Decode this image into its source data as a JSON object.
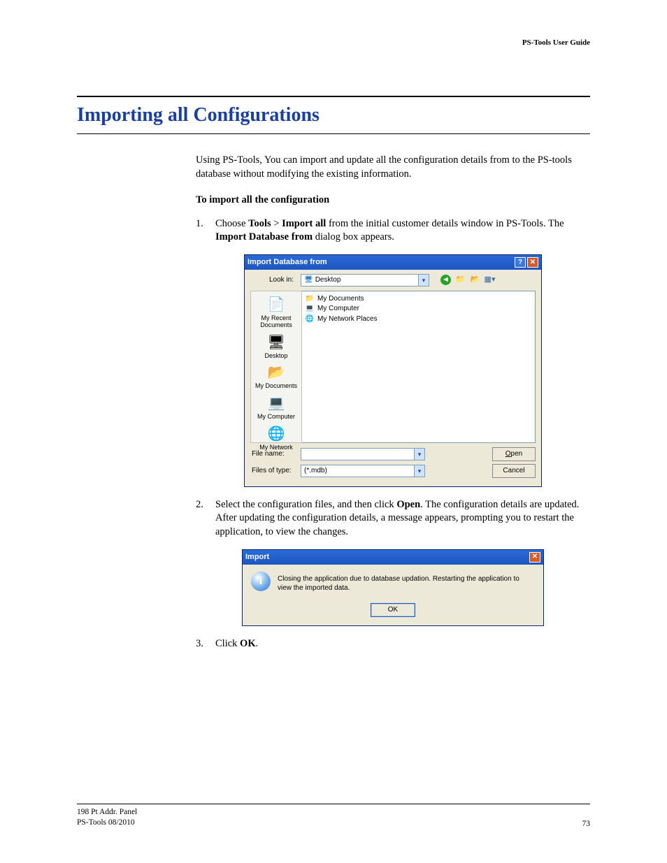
{
  "header": {
    "doc_title": "PS-Tools User Guide"
  },
  "section": {
    "title": "Importing all Configurations"
  },
  "intro": "Using PS-Tools, You can import and update all the configuration details from to the PS-tools database without modifying the existing information.",
  "subhead": "To import all the configuration",
  "steps": {
    "n1": "1.",
    "n2": "2.",
    "n3": "3.",
    "s1a": "Choose ",
    "s1_tools": "Tools",
    "s1_gt": " > ",
    "s1_import": "Import all",
    "s1b": " from the initial customer details window in PS-Tools. The ",
    "s1_dlg": "Import Database from",
    "s1c": " dialog box appears.",
    "s2a": "Select the configuration files, and then click ",
    "s2_open": "Open",
    "s2b": ". The configuration details are updated. After updating the configuration details, a message appears, prompting you to restart the application, to view the changes.",
    "s3a": "Click ",
    "s3_ok": "OK",
    "s3b": "."
  },
  "dlg1": {
    "title": "Import Database from",
    "lookin_label": "Look in:",
    "lookin_value": "Desktop",
    "places": {
      "recent": "My Recent Documents",
      "desktop": "Desktop",
      "mydocs": "My Documents",
      "mycomp": "My Computer",
      "mynet": "My Network"
    },
    "entries": {
      "e1": "My Documents",
      "e2": "My Computer",
      "e3": "My Network Places"
    },
    "file_name_label": "File name:",
    "file_type_label": "Files of type:",
    "file_type_value": "(*.mdb)",
    "open_btn_u": "O",
    "open_btn_r": "pen",
    "cancel_btn": "Cancel"
  },
  "dlg2": {
    "title": "Import",
    "message": "Closing the application due to database updation. Restarting the application to view the imported data.",
    "ok": "OK"
  },
  "footer": {
    "line1": "198 Pt Addr. Panel",
    "line2": "PS-Tools  08/2010",
    "page": "73"
  }
}
